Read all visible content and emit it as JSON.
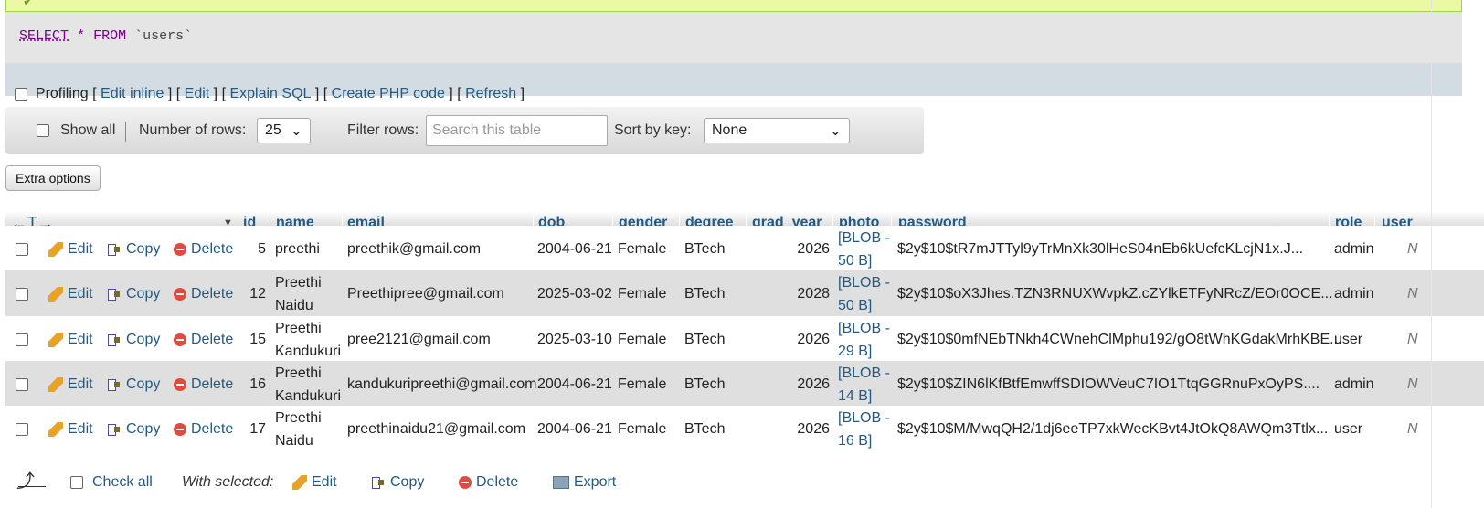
{
  "sql": {
    "keyword_select": "SELECT",
    "star": "*",
    "keyword_from": "FROM",
    "table": "`users`"
  },
  "profiling": {
    "label": "Profiling",
    "links": [
      "Edit inline",
      "Edit",
      "Explain SQL",
      "Create PHP code",
      "Refresh"
    ]
  },
  "navigation": {
    "show_all_label": "Show all",
    "rows_label": "Number of rows:",
    "rows_value": "25",
    "filter_label": "Filter rows:",
    "filter_placeholder": "Search this table",
    "sort_label": "Sort by key:",
    "sort_value": "None"
  },
  "extra_options_label": "Extra options",
  "table": {
    "arrows": "←T→",
    "columns": [
      "id",
      "name",
      "email",
      "dob",
      "gender",
      "degree",
      "grad_year",
      "photo",
      "password",
      "role",
      "user_"
    ],
    "action_labels": {
      "edit": "Edit",
      "copy": "Copy",
      "delete": "Delete"
    },
    "rows": [
      {
        "id": "5",
        "name1": "preethi",
        "name2": "",
        "email": "preethik@gmail.com",
        "dob": "2004-06-21",
        "gender": "Female",
        "degree": "BTech",
        "grad_year": "2026",
        "photo1": "[BLOB -",
        "photo2": "50 B]",
        "password": "$2y$10$tR7mJTTyl9yTrMnXk30lHeS04nEb6kUefcKLcjN1x.J...",
        "role": "admin",
        "extra": "N"
      },
      {
        "id": "12",
        "name1": "Preethi",
        "name2": "Naidu",
        "email": "Preethipree@gmail.com",
        "dob": "2025-03-02",
        "gender": "Female",
        "degree": "BTech",
        "grad_year": "2028",
        "photo1": "[BLOB -",
        "photo2": "50 B]",
        "password": "$2y$10$oX3Jhes.TZN3RNUXWvpkZ.cZYlkETFyNRcZ/EOr0OCE...",
        "role": "admin",
        "extra": "N"
      },
      {
        "id": "15",
        "name1": "Preethi",
        "name2": "Kandukuri",
        "email": "pree2121@gmail.com",
        "dob": "2025-03-10",
        "gender": "Female",
        "degree": "BTech",
        "grad_year": "2026",
        "photo1": "[BLOB -",
        "photo2": "29 B]",
        "password": "$2y$10$0mfNEbTNkh4CWnehClMphu192/gO8tWhKGdakMrhKBE...",
        "role": "user",
        "extra": "N"
      },
      {
        "id": "16",
        "name1": "Preethi",
        "name2": "Kandukuri",
        "email": "kandukuripreethi@gmail.com",
        "dob": "2004-06-21",
        "gender": "Female",
        "degree": "BTech",
        "grad_year": "2026",
        "photo1": "[BLOB -",
        "photo2": "14 B]",
        "password": "$2y$10$ZIN6lKfBtfEmwffSDIOWVeuC7IO1TtqGGRnuPxOyPS....",
        "role": "admin",
        "extra": "N"
      },
      {
        "id": "17",
        "name1": "Preethi",
        "name2": "Naidu",
        "email": "preethinaidu21@gmail.com",
        "dob": "2004-06-21",
        "gender": "Female",
        "degree": "BTech",
        "grad_year": "2026",
        "photo1": "[BLOB -",
        "photo2": "16 B]",
        "password": "$2y$10$M/MwqQH2/1dj6eeTP7xkWecKBvt4JtOkQ8AWQm3Ttlx...",
        "role": "user",
        "extra": "N"
      }
    ]
  },
  "footer": {
    "check_all": "Check all",
    "with_selected": "With selected:",
    "edit": "Edit",
    "copy": "Copy",
    "delete": "Delete",
    "export": "Export"
  },
  "colors": {
    "link": "#235a81",
    "success_bg": "#ebf8a4",
    "row_alt": "#dfdfdf"
  }
}
